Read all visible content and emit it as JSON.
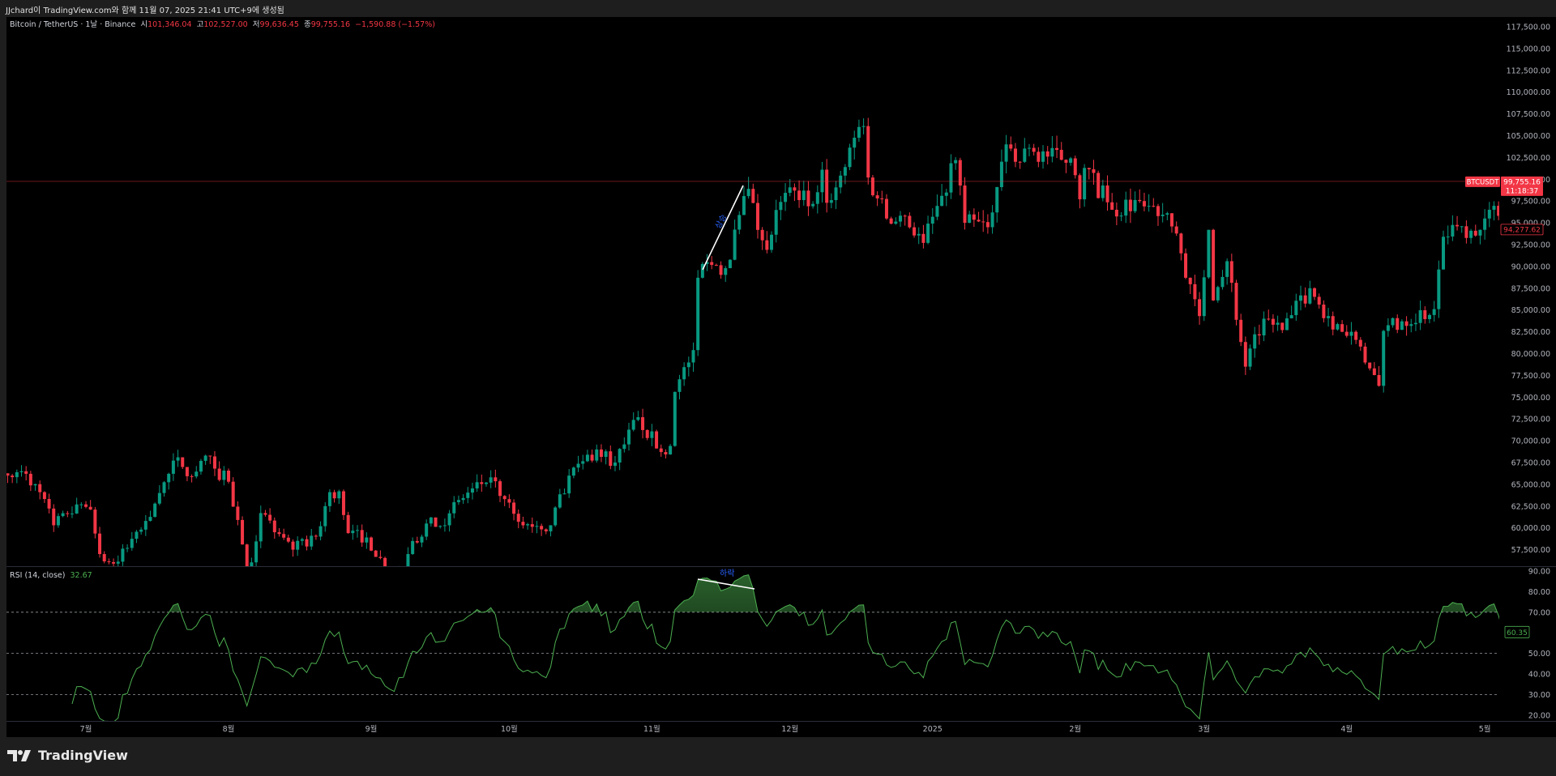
{
  "header": {
    "title": "JJchard이 TradingView.com와 함께 11월 07, 2025 21:41 UTC+9에 생성됨"
  },
  "legend": {
    "symbol": "Bitcoin / TetherUS · 1날 · Binance",
    "open_label": "시",
    "open": "101,346.04",
    "high_label": "고",
    "high": "102,527.00",
    "low_label": "저",
    "low": "99,636.45",
    "close_label": "종",
    "close": "99,755.16",
    "change": "−1,590.88 (−1.57%)"
  },
  "rsi_legend": {
    "name": "RSI (14, close)",
    "value": "32.67"
  },
  "price_tags": {
    "symbol": "BTCUSDT",
    "price": "99,755.16",
    "countdown": "11:18:37",
    "last": "94,277.62"
  },
  "rsi_tag": "60.35",
  "annotations": {
    "up": "상승",
    "down": "하락"
  },
  "footer": {
    "brand": "TradingView"
  },
  "colors": {
    "up": "#089981",
    "down": "#f23645",
    "rsi": "#4caf50",
    "annotation_text": "#2962ff",
    "annotation_line": "#ffffff"
  },
  "chart_data": {
    "type": "candlestick",
    "symbol": "BTCUSDT",
    "interval": "1D",
    "price_axis": {
      "ylim": [
        56500,
        118500
      ],
      "ticks": [
        "117,500.00",
        "115,000.00",
        "112,500.00",
        "110,000.00",
        "107,500.00",
        "105,000.00",
        "102,500.00",
        "100,000.00",
        "97,500.00",
        "95,000.00",
        "92,500.00",
        "90,000.00",
        "87,500.00",
        "85,000.00",
        "82,500.00",
        "80,000.00",
        "77,500.00",
        "75,000.00",
        "72,500.00",
        "70,000.00",
        "67,500.00",
        "65,000.00",
        "62,500.00",
        "60,000.00",
        "57,500.00"
      ]
    },
    "rsi_axis": {
      "ticks": [
        "90.00",
        "80.00",
        "70.00",
        "60.00",
        "50.00",
        "40.00",
        "30.00",
        "20.00"
      ],
      "levels": [
        70,
        50,
        30
      ],
      "period": 14
    },
    "time_axis": [
      "7월",
      "8월",
      "9월",
      "10월",
      "11월",
      "12월",
      "2025",
      "2월",
      "3월",
      "4월",
      "5월"
    ],
    "close_anchors": [
      [
        "2024-06-14",
        66000
      ],
      [
        "2024-06-17",
        66500
      ],
      [
        "2024-06-21",
        64100
      ],
      [
        "2024-06-24",
        60300
      ],
      [
        "2024-06-27",
        61600
      ],
      [
        "2024-06-30",
        62700
      ],
      [
        "2024-07-02",
        62100
      ],
      [
        "2024-07-04",
        57000
      ],
      [
        "2024-07-07",
        55900
      ],
      [
        "2024-07-10",
        57700
      ],
      [
        "2024-07-14",
        60800
      ],
      [
        "2024-07-17",
        64000
      ],
      [
        "2024-07-21",
        68100
      ],
      [
        "2024-07-24",
        65900
      ],
      [
        "2024-07-28",
        68200
      ],
      [
        "2024-07-29",
        66800
      ],
      [
        "2024-08-01",
        65300
      ],
      [
        "2024-08-04",
        58100
      ],
      [
        "2024-08-05",
        54000
      ],
      [
        "2024-08-08",
        61700
      ],
      [
        "2024-08-12",
        59300
      ],
      [
        "2024-08-15",
        57500
      ],
      [
        "2024-08-20",
        59000
      ],
      [
        "2024-08-23",
        64100
      ],
      [
        "2024-08-25",
        64200
      ],
      [
        "2024-08-27",
        59400
      ],
      [
        "2024-08-31",
        58900
      ],
      [
        "2024-09-06",
        53900
      ],
      [
        "2024-09-09",
        57000
      ],
      [
        "2024-09-13",
        60500
      ],
      [
        "2024-09-17",
        60300
      ],
      [
        "2024-09-20",
        63200
      ],
      [
        "2024-09-27",
        65800
      ],
      [
        "2024-09-30",
        63300
      ],
      [
        "2024-10-03",
        60700
      ],
      [
        "2024-10-10",
        60300
      ],
      [
        "2024-10-14",
        66000
      ],
      [
        "2024-10-20",
        69000
      ],
      [
        "2024-10-24",
        67500
      ],
      [
        "2024-10-29",
        72700
      ],
      [
        "2024-11-03",
        68700
      ],
      [
        "2024-11-05",
        69400
      ],
      [
        "2024-11-06",
        75600
      ],
      [
        "2024-11-10",
        80400
      ],
      [
        "2024-11-11",
        88700
      ],
      [
        "2024-11-13",
        90500
      ],
      [
        "2024-11-17",
        89800
      ],
      [
        "2024-11-22",
        98900
      ],
      [
        "2024-11-25",
        93000
      ],
      [
        "2024-11-26",
        91900
      ],
      [
        "2024-11-29",
        97400
      ],
      [
        "2024-12-04",
        98700
      ],
      [
        "2024-12-05",
        96900
      ],
      [
        "2024-12-08",
        101100
      ],
      [
        "2024-12-09",
        97300
      ],
      [
        "2024-12-13",
        101400
      ],
      [
        "2024-12-16",
        106000
      ],
      [
        "2024-12-17",
        106100
      ],
      [
        "2024-12-18",
        100200
      ],
      [
        "2024-12-20",
        97800
      ],
      [
        "2024-12-23",
        94900
      ],
      [
        "2024-12-26",
        95800
      ],
      [
        "2024-12-30",
        92700
      ],
      [
        "2025-01-03",
        98100
      ],
      [
        "2025-01-06",
        102200
      ],
      [
        "2025-01-08",
        95000
      ],
      [
        "2025-01-13",
        94500
      ],
      [
        "2025-01-17",
        104000
      ],
      [
        "2025-01-20",
        102000
      ],
      [
        "2025-01-22",
        103600
      ],
      [
        "2025-01-26",
        102600
      ],
      [
        "2025-01-31",
        102400
      ],
      [
        "2025-02-02",
        97700
      ],
      [
        "2025-02-03",
        101300
      ],
      [
        "2025-02-09",
        96500
      ],
      [
        "2025-02-15",
        97500
      ],
      [
        "2025-02-21",
        96100
      ],
      [
        "2025-02-24",
        91500
      ],
      [
        "2025-02-25",
        88700
      ],
      [
        "2025-02-28",
        84300
      ],
      [
        "2025-03-02",
        94200
      ],
      [
        "2025-03-03",
        86100
      ],
      [
        "2025-03-06",
        90600
      ],
      [
        "2025-03-10",
        78500
      ],
      [
        "2025-03-14",
        84000
      ],
      [
        "2025-03-18",
        82700
      ],
      [
        "2025-03-24",
        87500
      ],
      [
        "2025-03-28",
        84300
      ],
      [
        "2025-03-31",
        82500
      ],
      [
        "2025-04-02",
        82500
      ],
      [
        "2025-04-06",
        78300
      ],
      [
        "2025-04-08",
        76300
      ],
      [
        "2025-04-09",
        82600
      ],
      [
        "2025-04-13",
        83700
      ],
      [
        "2025-04-20",
        85100
      ],
      [
        "2025-04-22",
        93400
      ],
      [
        "2025-04-25",
        94600
      ],
      [
        "2025-04-30",
        94200
      ],
      [
        "2025-05-02",
        96500
      ],
      [
        "2025-05-04",
        95800
      ],
      [
        "2025-05-06",
        94277.62
      ]
    ],
    "price_line": 99755.16
  }
}
